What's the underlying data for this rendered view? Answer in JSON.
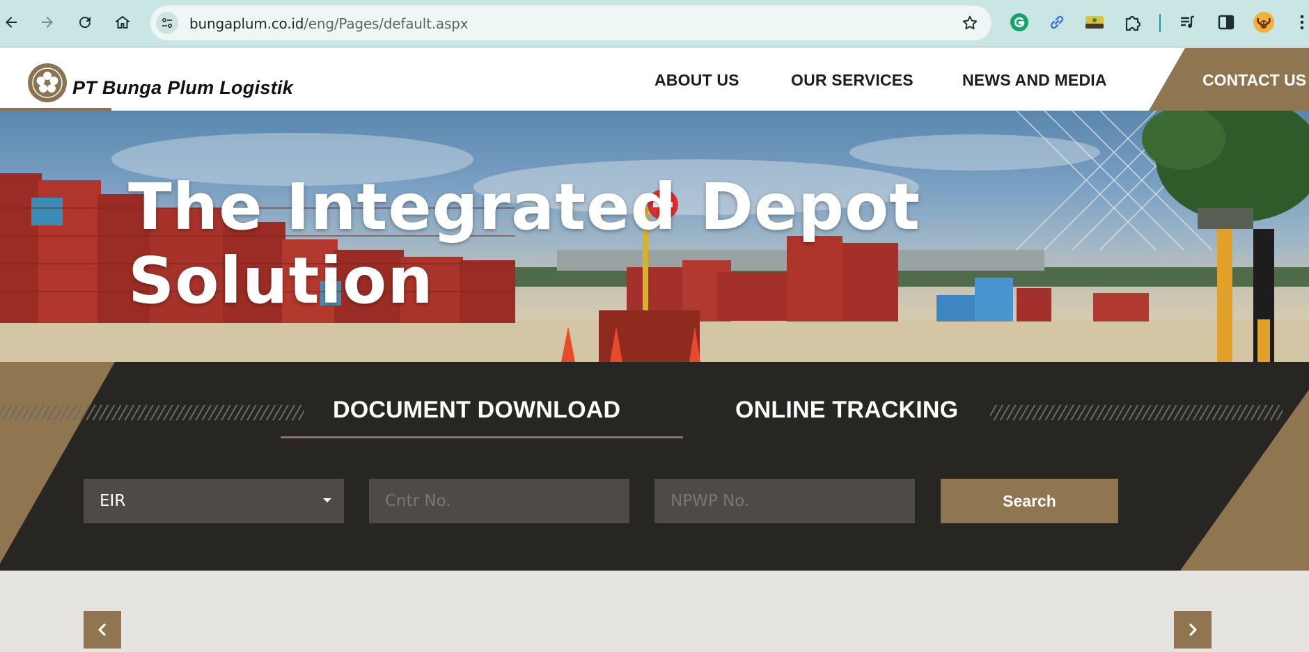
{
  "browser": {
    "url_domain": "bungaplum.co.id",
    "url_path": "/eng/Pages/default.aspx",
    "icons": {
      "back": "back-arrow-icon",
      "forward": "forward-arrow-icon",
      "reload": "reload-icon",
      "home": "home-icon",
      "site_info": "tune-icon",
      "bookmark": "star-icon"
    },
    "extensions": [
      "grammarly-icon",
      "link-icon",
      "extension-app-icon",
      "puzzle-icon",
      "media-queue-icon",
      "side-panel-icon",
      "profile-avatar-icon",
      "kebab-menu-icon"
    ]
  },
  "site": {
    "brand": "PT Bunga Plum Logistik",
    "brand_color": "#8f7550",
    "nav": {
      "about": "ABOUT US",
      "services": "OUR SERVICES",
      "news": "NEWS AND MEDIA",
      "contact": "CONTACT US"
    }
  },
  "hero": {
    "title_line1": "The Integrated Depot",
    "title_line2": "Solution"
  },
  "tracking": {
    "tabs": [
      {
        "label": "DOCUMENT DOWNLOAD",
        "active": true
      },
      {
        "label": "ONLINE TRACKING",
        "active": false
      }
    ],
    "document_type": {
      "selected": "EIR"
    },
    "container_no": {
      "placeholder": "Cntr No."
    },
    "npwp_no": {
      "placeholder": "NPWP No."
    },
    "search_label": "Search"
  },
  "carousel": {
    "prev_icon": "chevron-left-icon",
    "next_icon": "chevron-right-icon"
  }
}
